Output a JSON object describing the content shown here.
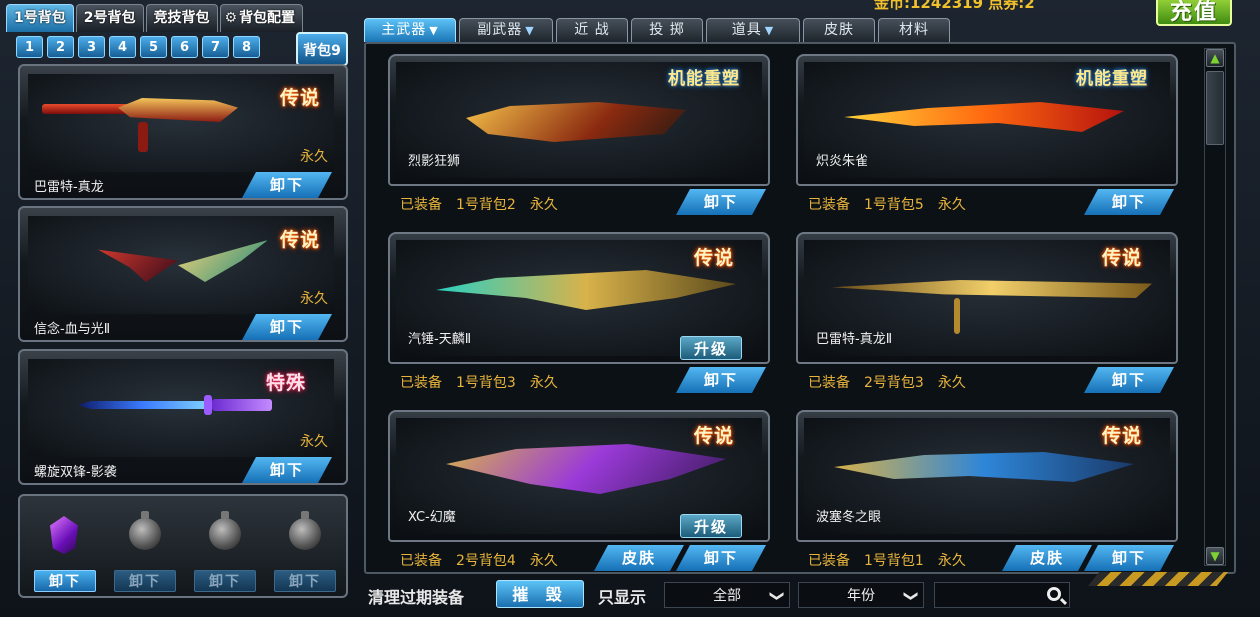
{
  "header": {
    "bag_tabs": [
      {
        "label": "1号背包",
        "active": true
      },
      {
        "label": "2号背包",
        "active": false
      },
      {
        "label": "竞技背包",
        "active": false
      },
      {
        "label": "背包配置",
        "active": false
      }
    ],
    "gear_icon": "gear-icon",
    "bag_numbers": [
      "1",
      "2",
      "3",
      "4",
      "5",
      "6",
      "7",
      "8"
    ],
    "bag9_label": "背包9",
    "gold_text": "金币:1242319   点券:2",
    "recharge_label": "充值"
  },
  "left_slots": [
    {
      "name": "巴雷特-真龙",
      "rarity": "传说",
      "duration": "永久",
      "unload": "卸下"
    },
    {
      "name": "信念-血与光Ⅱ",
      "rarity": "传说",
      "duration": "永久",
      "unload": "卸下"
    },
    {
      "name": "螺旋双锋-影袭",
      "rarity": "特殊",
      "duration": "永久",
      "unload": "卸下"
    }
  ],
  "grenades": {
    "buttons": [
      "卸下",
      "卸下",
      "卸下",
      "卸下"
    ]
  },
  "categories": [
    {
      "label": "主武器",
      "dropdown": true,
      "active": true
    },
    {
      "label": "副武器",
      "dropdown": true,
      "active": false
    },
    {
      "label": "近 战",
      "dropdown": false,
      "active": false
    },
    {
      "label": "投 掷",
      "dropdown": false,
      "active": false
    },
    {
      "label": "道具",
      "dropdown": true,
      "active": false
    },
    {
      "label": "皮肤",
      "dropdown": false,
      "active": false
    },
    {
      "label": "材料",
      "dropdown": false,
      "active": false
    }
  ],
  "cards": [
    {
      "name": "烈影狂狮",
      "badge": "机能重塑",
      "status": "已装备",
      "bag": "1号背包2",
      "duration": "永久",
      "unload": "卸下"
    },
    {
      "name": "炽炎朱雀",
      "badge": "机能重塑",
      "status": "已装备",
      "bag": "1号背包5",
      "duration": "永久",
      "unload": "卸下"
    },
    {
      "name": "汽锤-天麟Ⅱ",
      "badge": "传说",
      "status": "已装备",
      "bag": "1号背包3",
      "duration": "永久",
      "unload": "卸下",
      "upgrade": "升级"
    },
    {
      "name": "巴雷特-真龙Ⅱ",
      "badge": "传说",
      "status": "已装备",
      "bag": "2号背包3",
      "duration": "永久",
      "unload": "卸下"
    },
    {
      "name": "XC-幻魔",
      "badge": "传说",
      "status": "已装备",
      "bag": "2号背包4",
      "duration": "永久",
      "unload": "卸下",
      "upgrade": "升级",
      "skin": "皮肤"
    },
    {
      "name": "波塞冬之眼",
      "badge": "传说",
      "status": "已装备",
      "bag": "1号背包1",
      "duration": "永久",
      "unload": "卸下",
      "skin": "皮肤"
    }
  ],
  "bottom": {
    "clear_label": "清理过期装备",
    "destroy_label": "摧 毁",
    "show_only_label": "只显示",
    "filter_all": "全部",
    "filter_year": "年份",
    "search_value": ""
  },
  "colors": {
    "accent_blue": "#1c75b6",
    "gold_text": "#e8b43c",
    "recharge_green": "#6ab725"
  }
}
